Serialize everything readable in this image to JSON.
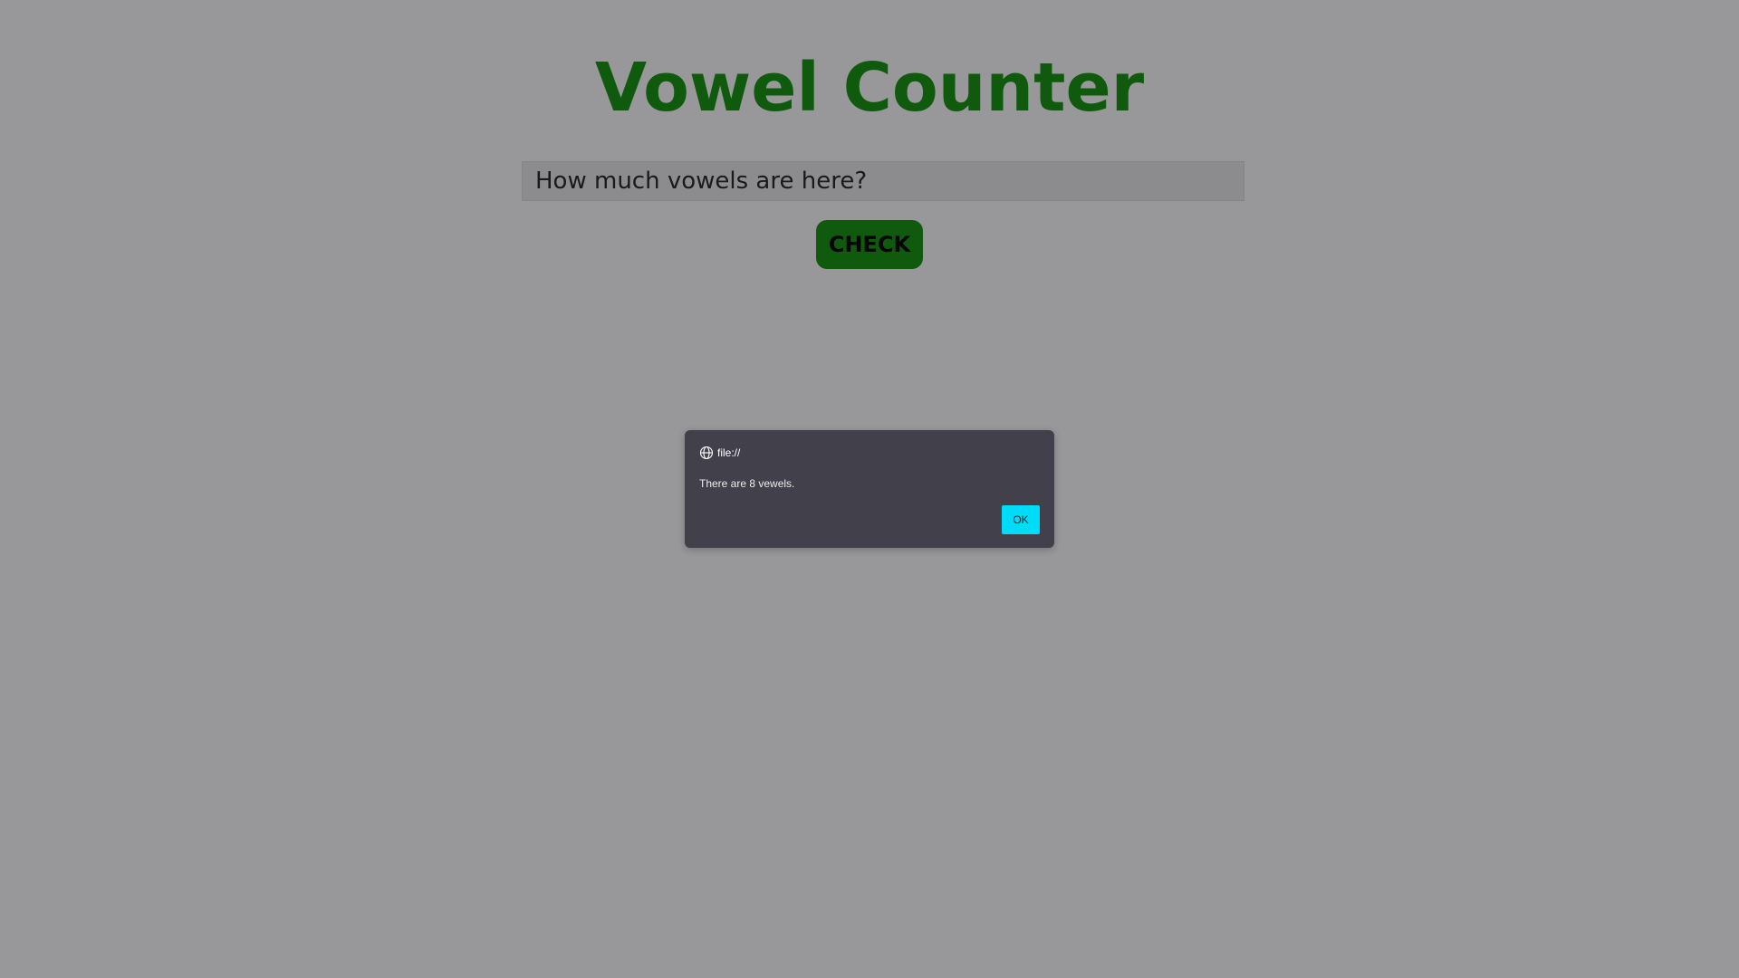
{
  "app": {
    "title": "Vowel Counter"
  },
  "form": {
    "input_value": "How much vowels are here?",
    "check_label": "CHECK"
  },
  "dialog": {
    "origin": "file://",
    "origin_icon": "globe-icon",
    "message": "There are 8 vewels.",
    "ok_label": "OK"
  },
  "colors": {
    "page_background": "#98989a",
    "title_green": "#0f5a0d",
    "button_green": "#0f5a0d",
    "dialog_background": "#42404b",
    "ok_button": "#00dcf7"
  }
}
